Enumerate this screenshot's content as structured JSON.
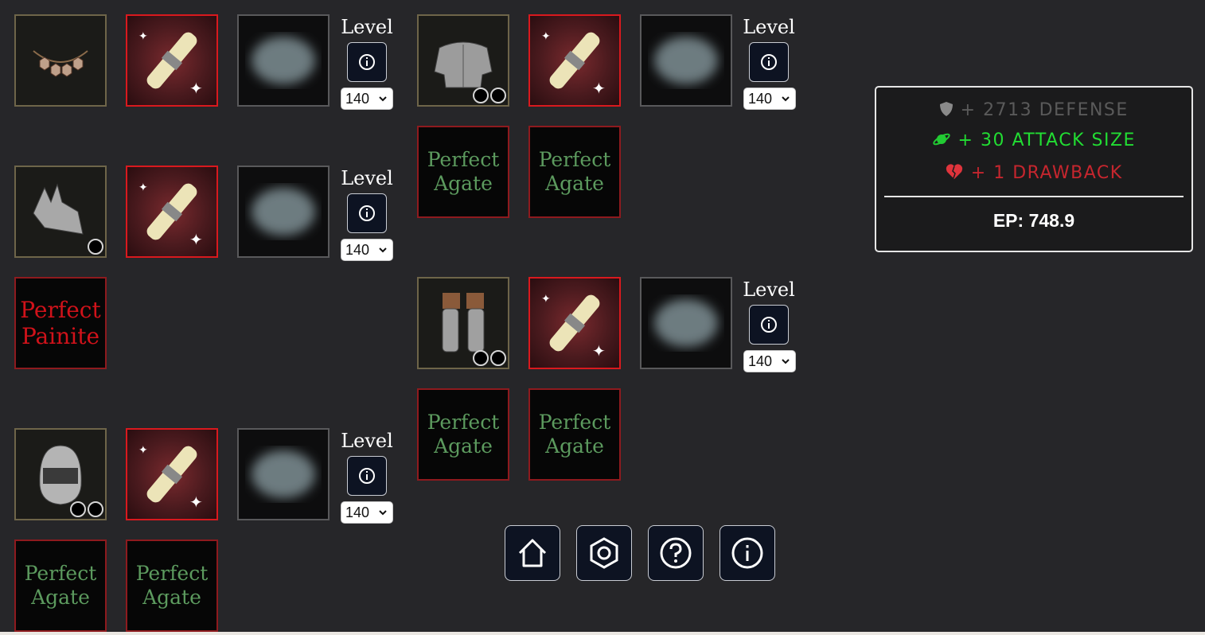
{
  "level_label": "Level",
  "level_value": "140",
  "gems": {
    "agate": "Perfect Agate",
    "painite": "Perfect Painite"
  },
  "equipment": [
    {
      "slot": "necklace",
      "sockets": 0
    },
    {
      "slot": "body-armor",
      "sockets": 2
    },
    {
      "slot": "shoulder-armor",
      "sockets": 1
    },
    {
      "slot": "leg-armor",
      "sockets": 2
    },
    {
      "slot": "helmet",
      "sockets": 2
    }
  ],
  "stats": {
    "defense": "+ 2713 DEFENSE",
    "attack_size": "+ 30 ATTACK SIZE",
    "drawback": "+ 1 DRAWBACK",
    "ep": "EP: 748.9"
  },
  "colors": {
    "background": "#262629",
    "scroll_border": "#d9191e",
    "agate_text": "#5c9a5e",
    "painite_text": "#d0121a",
    "defense_text": "#5a5a5a",
    "attack_text": "#22dd33",
    "drawback_text": "#c6262e",
    "button_bg": "#0d1322"
  },
  "nav": [
    "home-icon",
    "settings-icon",
    "help-icon",
    "info-icon"
  ]
}
